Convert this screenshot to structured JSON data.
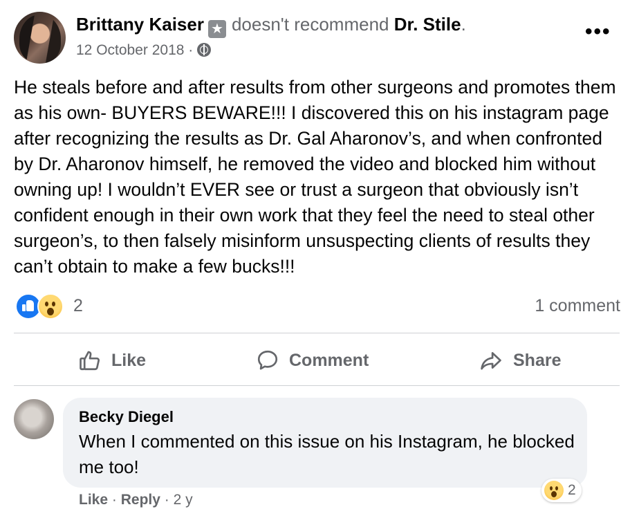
{
  "post": {
    "author": "Brittany Kaiser",
    "verb": "doesn't recommend",
    "target": "Dr. Stile",
    "target_suffix": ".",
    "date": "12 October 2018",
    "date_sep": "·",
    "audience_icon": "globe-icon",
    "more_icon": "more-options-icon",
    "body": "He steals before and after results from other surgeons and promotes them as his own- BUYERS BEWARE!!! I discovered this on his instagram page after recognizing the results as Dr. Gal Aharonov’s, and when confronted by Dr. Aharonov himself, he removed the video and blocked him without owning up! I wouldn’t EVER see or trust a surgeon that obviously isn’t confident enough in their own work that they feel the need to steal other surgeon’s, to then falsely misinform unsuspecting clients of results they can’t obtain to make a few bucks!!!",
    "reaction_count": "2",
    "comment_count": "1 comment",
    "reaction_icons": [
      "like-reaction-icon",
      "wow-reaction-icon"
    ]
  },
  "actions": {
    "like": "Like",
    "comment": "Comment",
    "share": "Share"
  },
  "comment": {
    "author": "Becky Diegel",
    "text": "When I commented on this issue on his Instagram, he blocked me too!",
    "reaction_count": "2",
    "like": "Like",
    "reply": "Reply",
    "sep": "·",
    "age": "2 y"
  },
  "colors": {
    "primary_text": "#050505",
    "secondary_text": "#65676b",
    "like_blue": "#1877f2",
    "bubble_bg": "#f0f2f5"
  }
}
